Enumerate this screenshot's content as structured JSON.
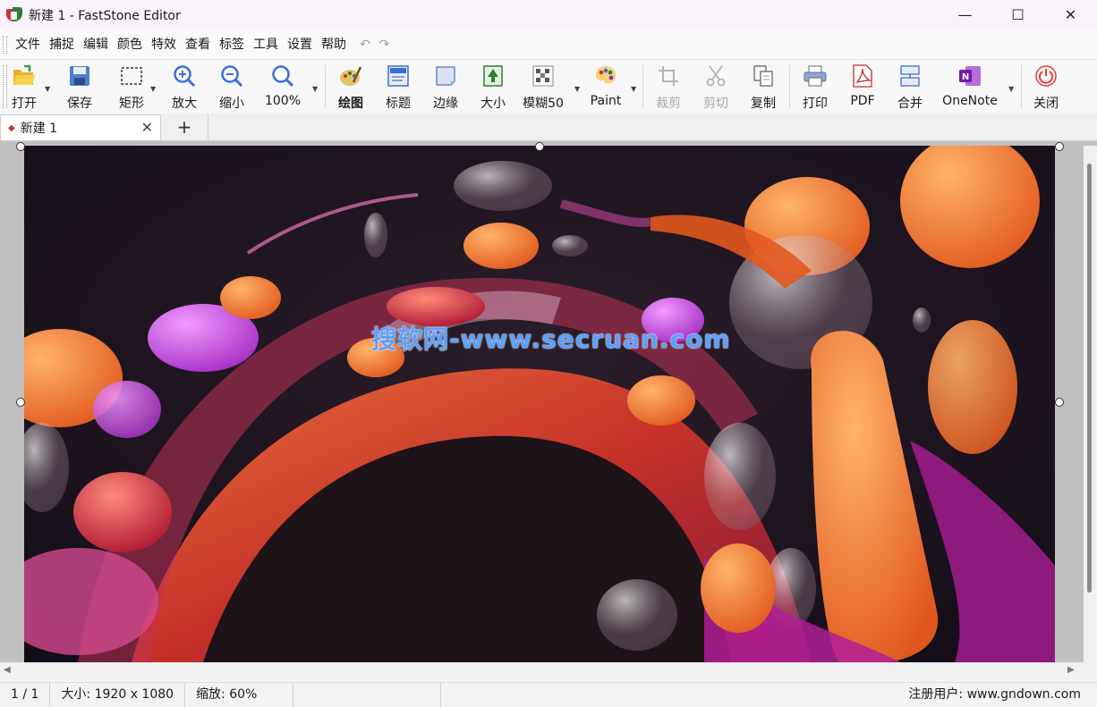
{
  "window": {
    "title": "新建 1 - FastStone Editor",
    "controls": {
      "minimize": "—",
      "maximize": "☐",
      "close": "✕"
    }
  },
  "menu": {
    "items": [
      "文件",
      "捕捉",
      "编辑",
      "颜色",
      "特效",
      "查看",
      "标签",
      "工具",
      "设置",
      "帮助"
    ],
    "undo": "↶",
    "redo": "↷"
  },
  "toolbar": {
    "open": "打开",
    "save": "保存",
    "rect": "矩形",
    "zoom_in": "放大",
    "zoom_out": "缩小",
    "zoom_100": "100%",
    "draw": "绘图",
    "caption": "标题",
    "edge": "边缘",
    "resize": "大小",
    "blur": "模糊50",
    "paint": "Paint",
    "crop": "裁剪",
    "cut": "剪切",
    "copy": "复制",
    "print": "打印",
    "pdf": "PDF",
    "merge": "合并",
    "onenote": "OneNote",
    "close": "关闭"
  },
  "tabs": [
    {
      "label": "新建 1",
      "close": "✕"
    }
  ],
  "tab_add": "+",
  "image": {
    "watermark": "搜软网-www.secruan.com"
  },
  "status": {
    "page": "1 / 1",
    "size_label": "大小:",
    "size_value": "1920 x 1080",
    "zoom_label": "缩放:",
    "zoom_value": "60%",
    "registered": "注册用户: www.gndown.com"
  },
  "colors": {
    "accent_blue": "#3a6fd8",
    "close_red": "#d32f2f"
  }
}
